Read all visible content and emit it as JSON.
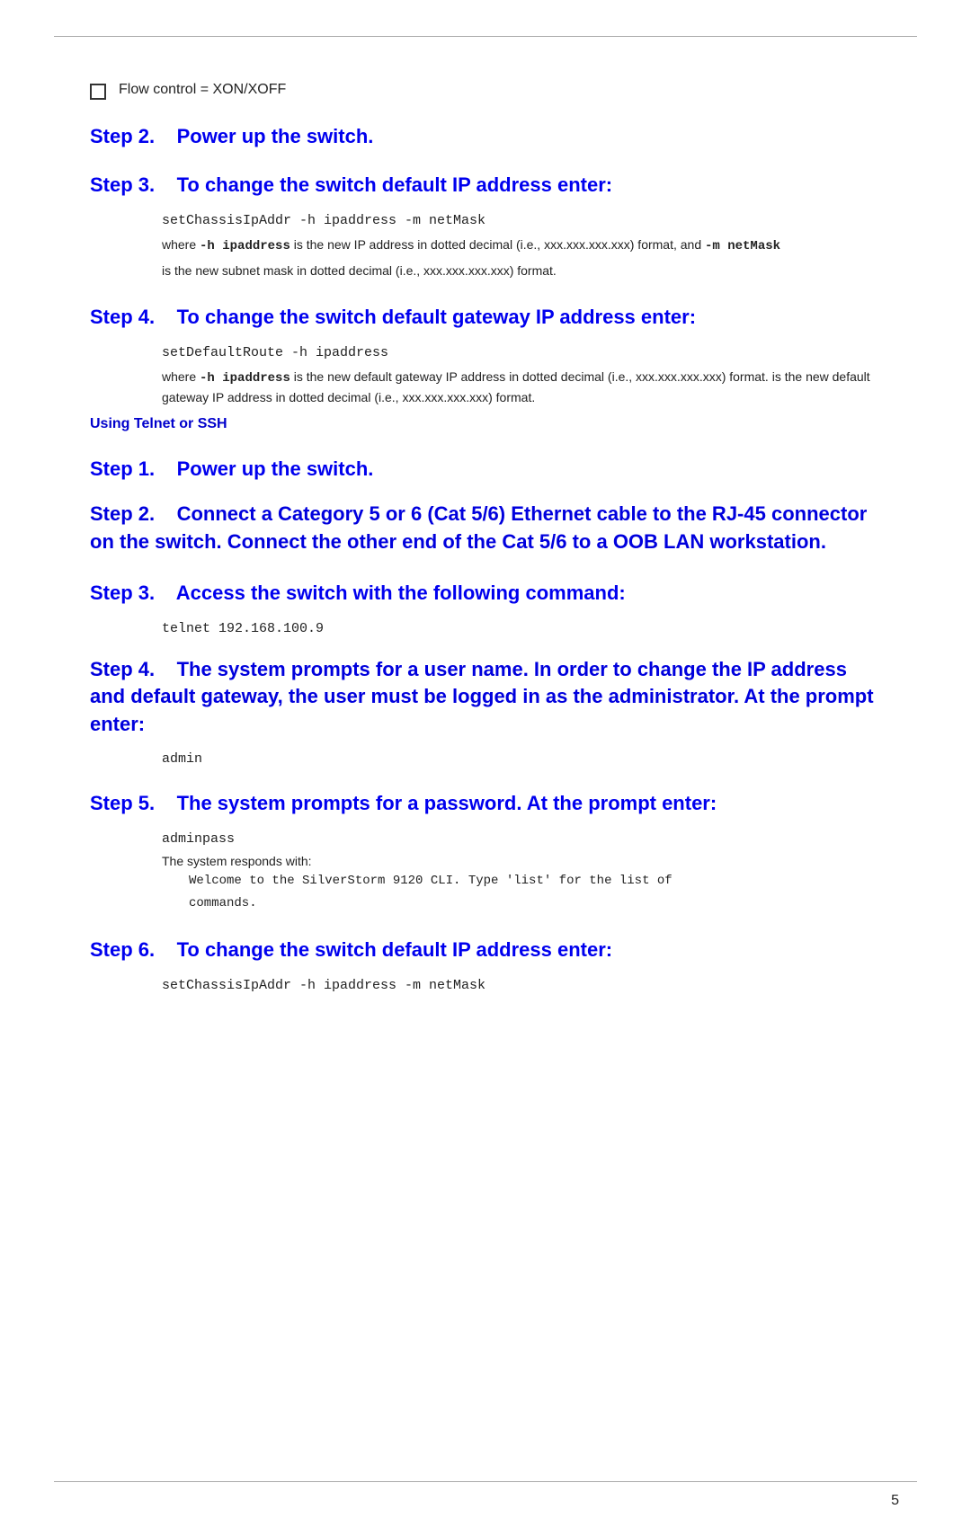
{
  "page": {
    "page_number": "5"
  },
  "bullet_item": {
    "text": "Flow control = XON/XOFF"
  },
  "step2_title": "Step 2.    Power up the switch.",
  "step3_title": "Step 3.    To change the switch default IP address enter:",
  "step3_code": "setChassisIpAddr -h ipaddress -m netMask",
  "step3_desc1_pre": "where ",
  "step3_desc1_bold1": "-h ipaddress",
  "step3_desc1_mid1": " is the new IP address in dotted decimal (i.e., xxx.xxx.xxx.xxx) format, and ",
  "step3_desc1_bold2": "-m netMask",
  "step3_desc1_end": "",
  "step3_desc2": "is the new subnet mask in dotted decimal (i.e., xxx.xxx.xxx.xxx) format.",
  "step4_title": "Step 4.    To change the switch default gateway IP address enter:",
  "step4_code": "setDefaultRoute -h ipaddress",
  "step4_desc_pre": "where ",
  "step4_desc_bold": "-h ipaddress",
  "step4_desc_end": " is the new default gateway IP address in dotted decimal (i.e., xxx.xxx.xxx.xxx) format.",
  "using_label": "Using Telnet or SSH",
  "ssh_step1_title": "Step 1.    Power up the switch.",
  "ssh_step2_title": "Step 2.    Connect a Category 5 or 6 (Cat 5/6) Ethernet cable to the RJ-45 connector on the switch. Connect the other end of the Cat 5/6 to a OOB LAN workstation.",
  "ssh_step3_title": "Step 3.    Access the switch with the following command:",
  "ssh_step3_code": "telnet 192.168.100.9",
  "ssh_step4_title": "Step 4.    The system prompts for a user name. In order to change the IP address and default gateway, the user must be logged in as the administrator. At the prompt enter:",
  "ssh_step4_code": "admin",
  "ssh_step5_title": "Step 5.    The system prompts for a password. At the prompt enter:",
  "ssh_step5_code": "adminpass",
  "system_responds_label": "The system responds with:",
  "welcome_message_line1": "Welcome to the SilverStorm 9120 CLI. Type 'list' for the list of",
  "welcome_message_line2": "commands.",
  "ssh_step6_title": "Step 6.    To change the switch default IP address enter:",
  "ssh_step6_code": "setChassisIpAddr -h ipaddress -m netMask"
}
